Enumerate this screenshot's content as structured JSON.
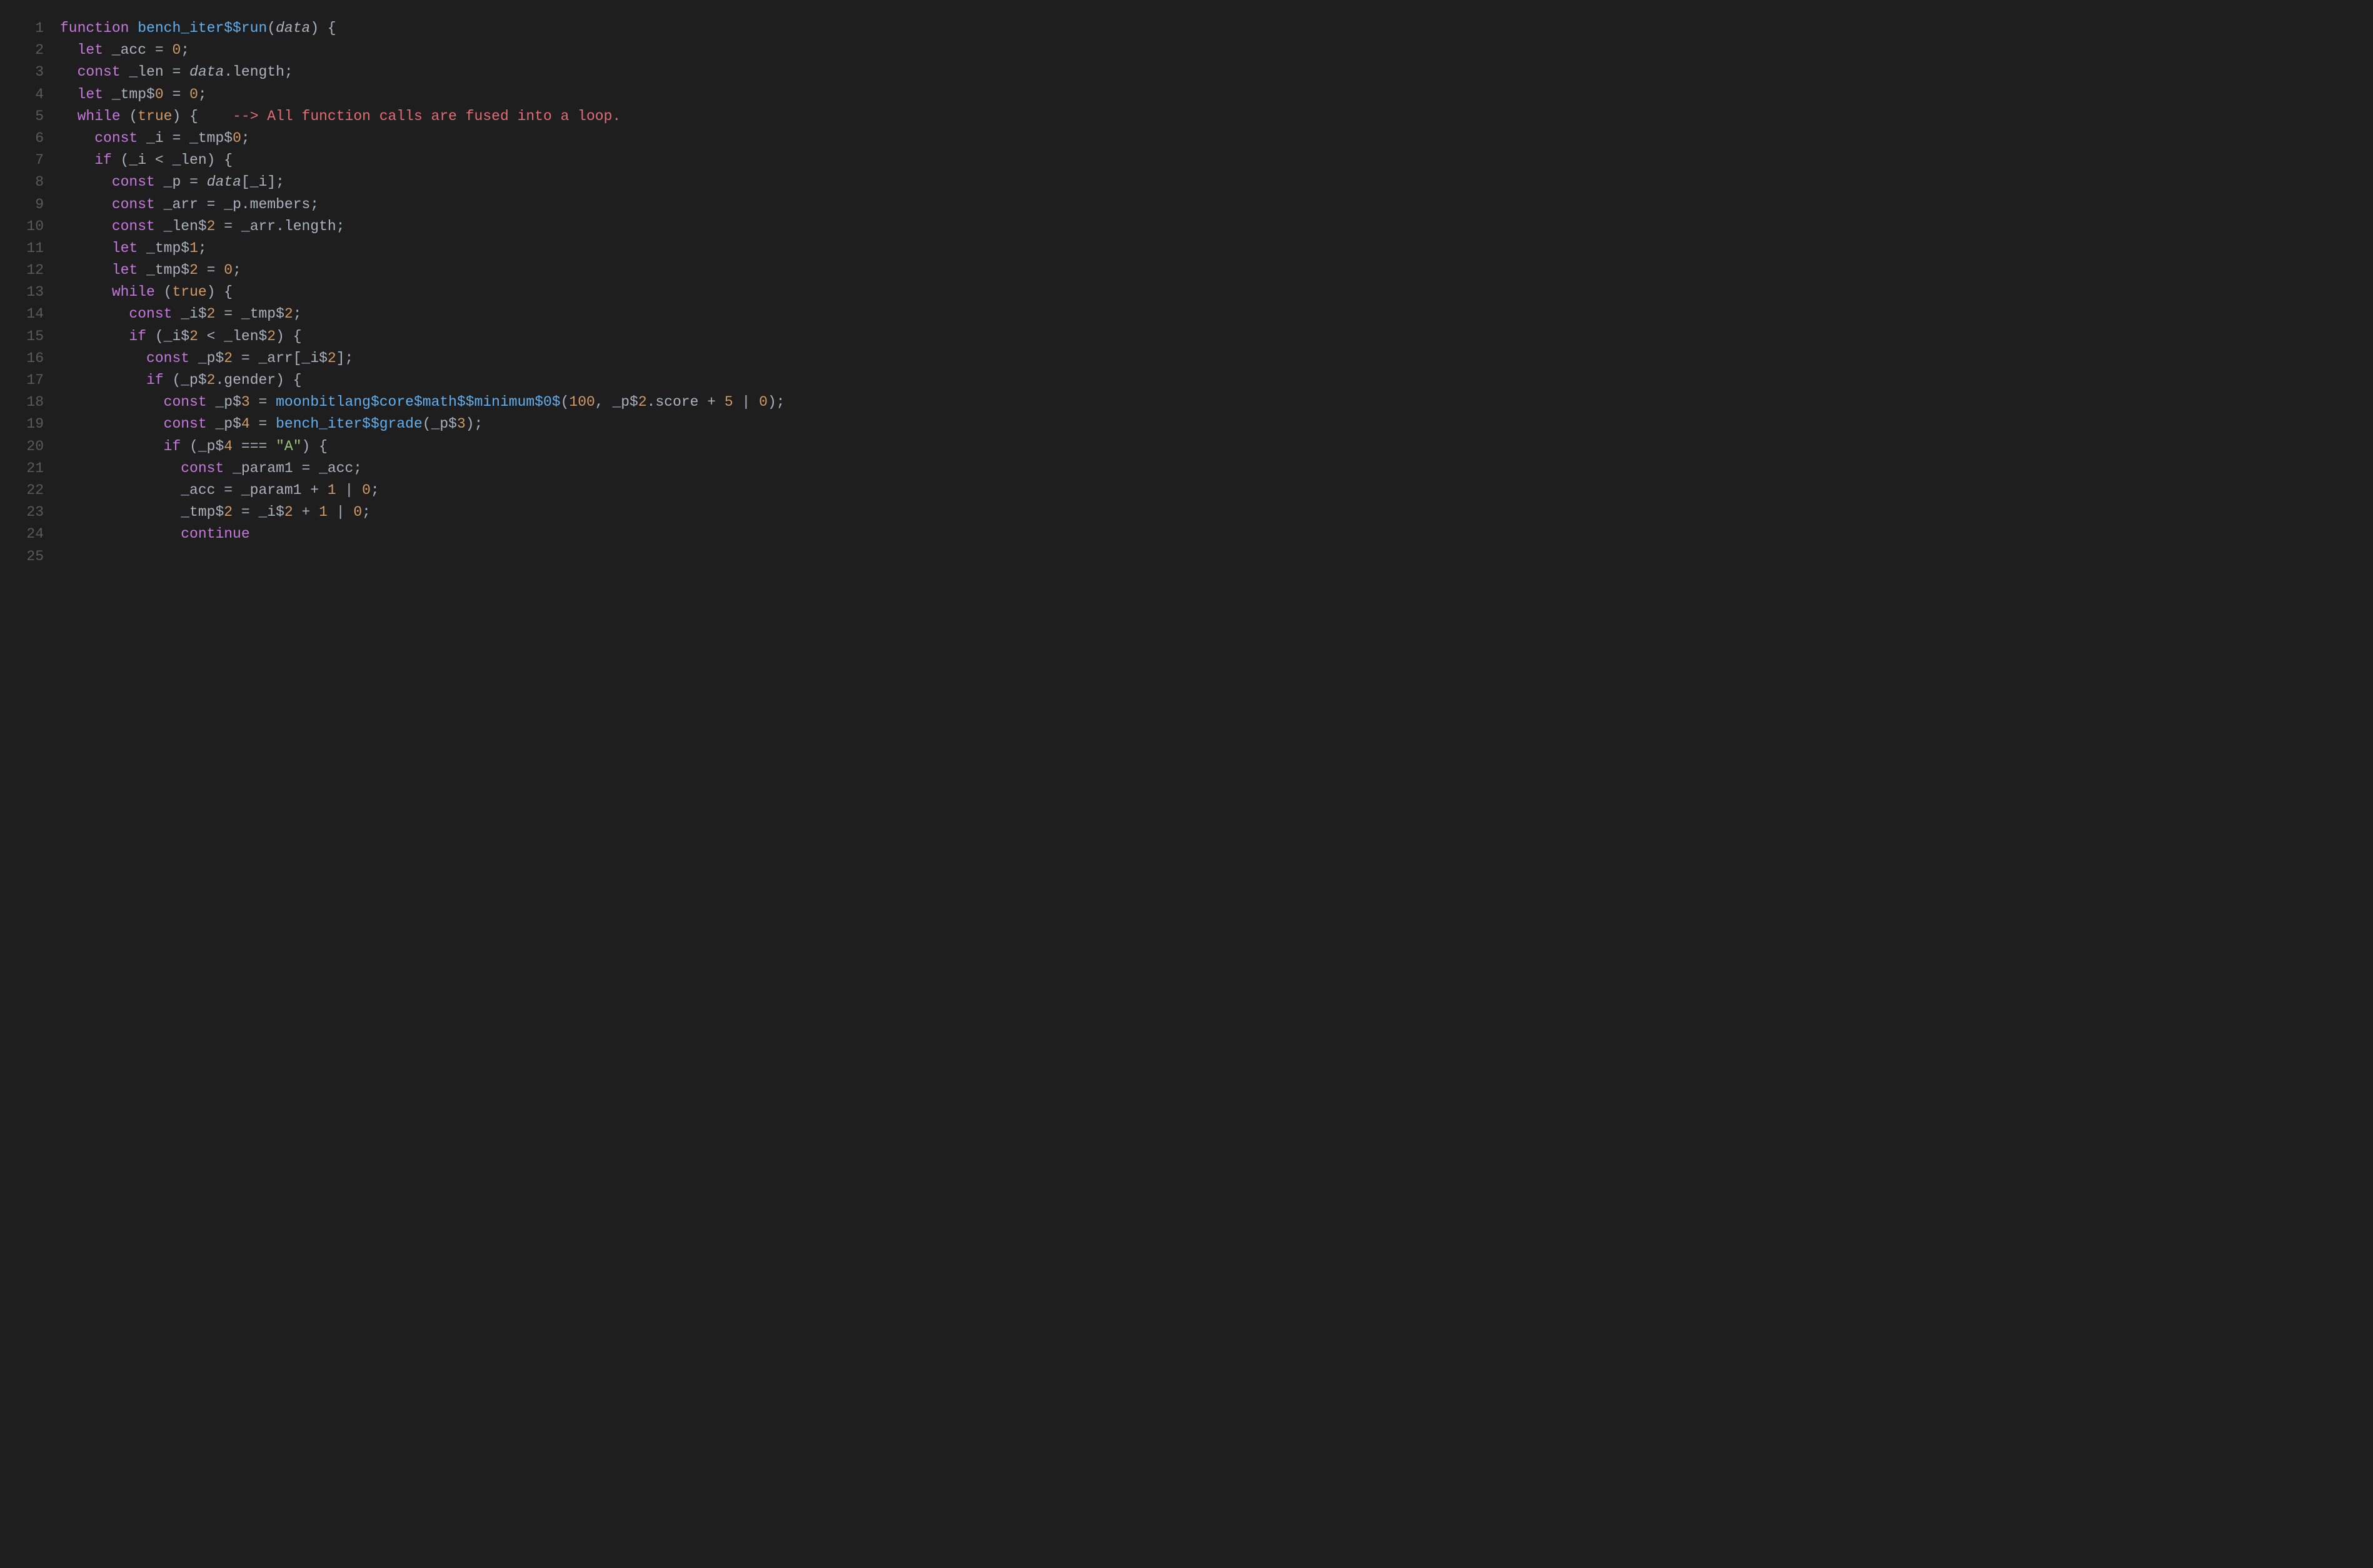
{
  "lines": [
    {
      "num": "1",
      "tokens": [
        {
          "t": "function ",
          "c": "kw"
        },
        {
          "t": "bench_iter$$run",
          "c": "fn"
        },
        {
          "t": "(",
          "c": "op"
        },
        {
          "t": "data",
          "c": "param"
        },
        {
          "t": ") {",
          "c": "op"
        }
      ]
    },
    {
      "num": "2",
      "tokens": [
        {
          "t": "  ",
          "c": ""
        },
        {
          "t": "let ",
          "c": "kw"
        },
        {
          "t": "_acc ",
          "c": "var"
        },
        {
          "t": "= ",
          "c": "op"
        },
        {
          "t": "0",
          "c": "num"
        },
        {
          "t": ";",
          "c": "op"
        }
      ]
    },
    {
      "num": "3",
      "tokens": [
        {
          "t": "  ",
          "c": ""
        },
        {
          "t": "const ",
          "c": "kw"
        },
        {
          "t": "_len ",
          "c": "var"
        },
        {
          "t": "= ",
          "c": "op"
        },
        {
          "t": "data",
          "c": "param"
        },
        {
          "t": ".length;",
          "c": "op"
        }
      ]
    },
    {
      "num": "4",
      "tokens": [
        {
          "t": "  ",
          "c": ""
        },
        {
          "t": "let ",
          "c": "kw"
        },
        {
          "t": "_tmp$",
          "c": "var"
        },
        {
          "t": "0",
          "c": "num"
        },
        {
          "t": " = ",
          "c": "op"
        },
        {
          "t": "0",
          "c": "num"
        },
        {
          "t": ";",
          "c": "op"
        }
      ]
    },
    {
      "num": "5",
      "tokens": [
        {
          "t": "  ",
          "c": ""
        },
        {
          "t": "while ",
          "c": "kw"
        },
        {
          "t": "(",
          "c": "op"
        },
        {
          "t": "true",
          "c": "bool"
        },
        {
          "t": ") {    ",
          "c": "op"
        },
        {
          "t": "--> All function calls are fused into a loop.",
          "c": "comment"
        }
      ]
    },
    {
      "num": "6",
      "tokens": [
        {
          "t": "    ",
          "c": ""
        },
        {
          "t": "const ",
          "c": "kw"
        },
        {
          "t": "_i ",
          "c": "var"
        },
        {
          "t": "= _tmp$",
          "c": "op"
        },
        {
          "t": "0",
          "c": "num"
        },
        {
          "t": ";",
          "c": "op"
        }
      ]
    },
    {
      "num": "7",
      "tokens": [
        {
          "t": "    ",
          "c": ""
        },
        {
          "t": "if ",
          "c": "kw"
        },
        {
          "t": "(_i < _len) {",
          "c": "op"
        }
      ]
    },
    {
      "num": "8",
      "tokens": [
        {
          "t": "      ",
          "c": ""
        },
        {
          "t": "const ",
          "c": "kw"
        },
        {
          "t": "_p ",
          "c": "var"
        },
        {
          "t": "= ",
          "c": "op"
        },
        {
          "t": "data",
          "c": "param"
        },
        {
          "t": "[_i];",
          "c": "op"
        }
      ]
    },
    {
      "num": "9",
      "tokens": [
        {
          "t": "      ",
          "c": ""
        },
        {
          "t": "const ",
          "c": "kw"
        },
        {
          "t": "_arr ",
          "c": "var"
        },
        {
          "t": "= _p.members;",
          "c": "op"
        }
      ]
    },
    {
      "num": "10",
      "tokens": [
        {
          "t": "      ",
          "c": ""
        },
        {
          "t": "const ",
          "c": "kw"
        },
        {
          "t": "_len$",
          "c": "var"
        },
        {
          "t": "2",
          "c": "num"
        },
        {
          "t": " = _arr.length;",
          "c": "op"
        }
      ]
    },
    {
      "num": "11",
      "tokens": [
        {
          "t": "      ",
          "c": ""
        },
        {
          "t": "let ",
          "c": "kw"
        },
        {
          "t": "_tmp$",
          "c": "var"
        },
        {
          "t": "1",
          "c": "num"
        },
        {
          "t": ";",
          "c": "op"
        }
      ]
    },
    {
      "num": "12",
      "tokens": [
        {
          "t": "      ",
          "c": ""
        },
        {
          "t": "let ",
          "c": "kw"
        },
        {
          "t": "_tmp$",
          "c": "var"
        },
        {
          "t": "2",
          "c": "num"
        },
        {
          "t": " = ",
          "c": "op"
        },
        {
          "t": "0",
          "c": "num"
        },
        {
          "t": ";",
          "c": "op"
        }
      ]
    },
    {
      "num": "13",
      "tokens": [
        {
          "t": "      ",
          "c": ""
        },
        {
          "t": "while ",
          "c": "kw"
        },
        {
          "t": "(",
          "c": "op"
        },
        {
          "t": "true",
          "c": "bool"
        },
        {
          "t": ") {",
          "c": "op"
        }
      ]
    },
    {
      "num": "14",
      "tokens": [
        {
          "t": "        ",
          "c": ""
        },
        {
          "t": "const ",
          "c": "kw"
        },
        {
          "t": "_i$",
          "c": "var"
        },
        {
          "t": "2",
          "c": "num"
        },
        {
          "t": " = _tmp$",
          "c": "op"
        },
        {
          "t": "2",
          "c": "num"
        },
        {
          "t": ";",
          "c": "op"
        }
      ]
    },
    {
      "num": "15",
      "tokens": [
        {
          "t": "        ",
          "c": ""
        },
        {
          "t": "if ",
          "c": "kw"
        },
        {
          "t": "(_i$",
          "c": "op"
        },
        {
          "t": "2",
          "c": "num"
        },
        {
          "t": " < _len$",
          "c": "op"
        },
        {
          "t": "2",
          "c": "num"
        },
        {
          "t": ") {",
          "c": "op"
        }
      ]
    },
    {
      "num": "16",
      "tokens": [
        {
          "t": "          ",
          "c": ""
        },
        {
          "t": "const ",
          "c": "kw"
        },
        {
          "t": "_p$",
          "c": "var"
        },
        {
          "t": "2",
          "c": "num"
        },
        {
          "t": " = _arr[_i$",
          "c": "op"
        },
        {
          "t": "2",
          "c": "num"
        },
        {
          "t": "];",
          "c": "op"
        }
      ]
    },
    {
      "num": "17",
      "tokens": [
        {
          "t": "          ",
          "c": ""
        },
        {
          "t": "if ",
          "c": "kw"
        },
        {
          "t": "(_p$",
          "c": "op"
        },
        {
          "t": "2",
          "c": "num"
        },
        {
          "t": ".gender) {",
          "c": "op"
        }
      ]
    },
    {
      "num": "18",
      "tokens": [
        {
          "t": "            ",
          "c": ""
        },
        {
          "t": "const ",
          "c": "kw"
        },
        {
          "t": "_p$",
          "c": "var"
        },
        {
          "t": "3",
          "c": "num"
        },
        {
          "t": " = ",
          "c": "op"
        },
        {
          "t": "moonbitlang$core$math$$minimum$0$",
          "c": "fn"
        },
        {
          "t": "(",
          "c": "op"
        },
        {
          "t": "100",
          "c": "num"
        },
        {
          "t": ", _p$",
          "c": "op"
        },
        {
          "t": "2",
          "c": "num"
        },
        {
          "t": ".score + ",
          "c": "op"
        },
        {
          "t": "5",
          "c": "num"
        },
        {
          "t": " | ",
          "c": "op"
        },
        {
          "t": "0",
          "c": "num"
        },
        {
          "t": ");",
          "c": "op"
        }
      ]
    },
    {
      "num": "19",
      "tokens": [
        {
          "t": "            ",
          "c": ""
        },
        {
          "t": "const ",
          "c": "kw"
        },
        {
          "t": "_p$",
          "c": "var"
        },
        {
          "t": "4",
          "c": "num"
        },
        {
          "t": " = ",
          "c": "op"
        },
        {
          "t": "bench_iter$$grade",
          "c": "fn"
        },
        {
          "t": "(_p$",
          "c": "op"
        },
        {
          "t": "3",
          "c": "num"
        },
        {
          "t": ");",
          "c": "op"
        }
      ]
    },
    {
      "num": "20",
      "tokens": [
        {
          "t": "            ",
          "c": ""
        },
        {
          "t": "if ",
          "c": "kw"
        },
        {
          "t": "(_p$",
          "c": "op"
        },
        {
          "t": "4",
          "c": "num"
        },
        {
          "t": " === ",
          "c": "op"
        },
        {
          "t": "\"A\"",
          "c": "str"
        },
        {
          "t": ") {",
          "c": "op"
        }
      ]
    },
    {
      "num": "21",
      "tokens": [
        {
          "t": "              ",
          "c": ""
        },
        {
          "t": "const ",
          "c": "kw"
        },
        {
          "t": "_param1 ",
          "c": "var"
        },
        {
          "t": "= _acc;",
          "c": "op"
        }
      ]
    },
    {
      "num": "22",
      "tokens": [
        {
          "t": "              _acc = _param1 + ",
          "c": "op"
        },
        {
          "t": "1",
          "c": "num"
        },
        {
          "t": " | ",
          "c": "op"
        },
        {
          "t": "0",
          "c": "num"
        },
        {
          "t": ";",
          "c": "op"
        }
      ]
    },
    {
      "num": "23",
      "tokens": [
        {
          "t": "              _tmp$",
          "c": "op"
        },
        {
          "t": "2",
          "c": "num"
        },
        {
          "t": " = _i$",
          "c": "op"
        },
        {
          "t": "2",
          "c": "num"
        },
        {
          "t": " + ",
          "c": "op"
        },
        {
          "t": "1",
          "c": "num"
        },
        {
          "t": " | ",
          "c": "op"
        },
        {
          "t": "0",
          "c": "num"
        },
        {
          "t": ";",
          "c": "op"
        }
      ]
    },
    {
      "num": "24",
      "tokens": [
        {
          "t": "              ",
          "c": ""
        },
        {
          "t": "continue",
          "c": "kw"
        }
      ]
    },
    {
      "num": "25",
      "tokens": []
    }
  ]
}
